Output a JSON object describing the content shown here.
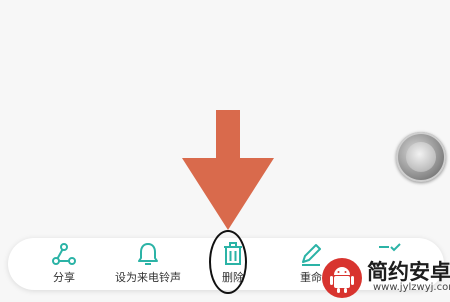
{
  "toolbar": {
    "items": [
      {
        "label": "分享",
        "icon": "share-icon"
      },
      {
        "label": "设为来电铃声",
        "icon": "bell-icon"
      },
      {
        "label": "删除",
        "icon": "trash-icon"
      },
      {
        "label": "重命",
        "icon": "pencil-icon"
      },
      {
        "label": "",
        "icon": "check-icon"
      }
    ]
  },
  "watermark": {
    "title": "简约安卓网",
    "url": "www.jylzwyj.com"
  },
  "colors": {
    "accent_teal": "#2bb3a6",
    "arrow_orange": "#d96a4c",
    "watermark_red": "#d8342f"
  }
}
